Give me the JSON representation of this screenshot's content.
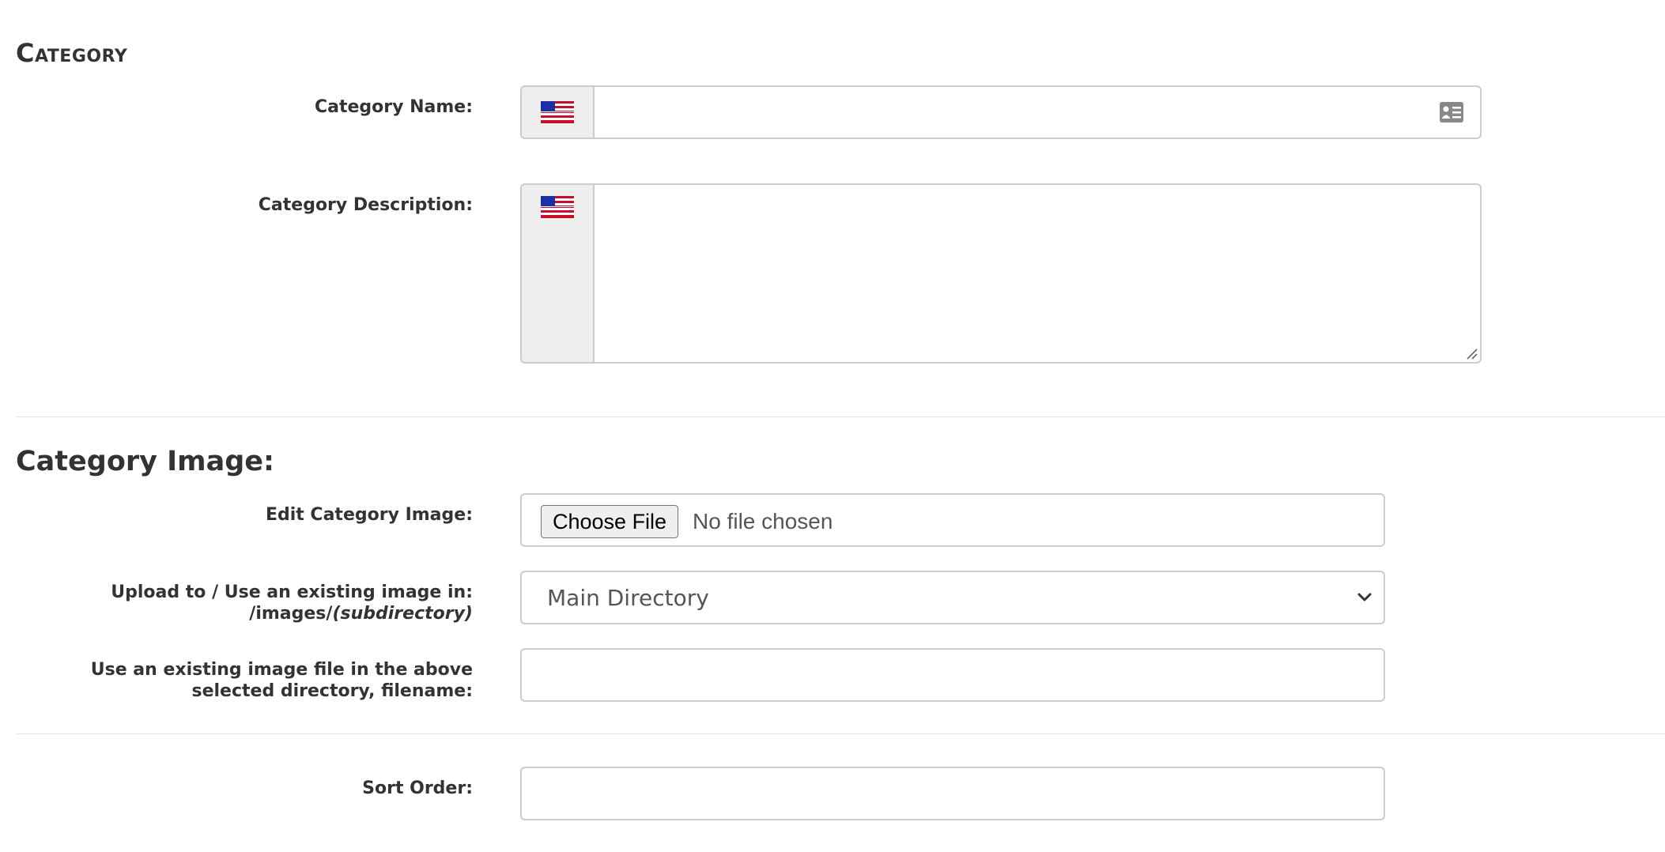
{
  "category_section": {
    "heading": "Category",
    "name_label": "Category Name:",
    "name_value": "",
    "name_flag_icon": "us-flag-icon",
    "name_card_icon": "contact-card-icon",
    "description_label": "Category Description:",
    "description_value": "",
    "description_flag_icon": "us-flag-icon"
  },
  "image_section": {
    "heading": "Category Image:",
    "edit_label": "Edit Category Image:",
    "choose_file_label": "Choose File",
    "no_file_text": "No file chosen",
    "upload_label_line1": "Upload to / Use an existing image in:",
    "upload_label_line2_prefix": "/images/",
    "upload_label_line2_em": "(subdirectory)",
    "directory_selected": "Main Directory",
    "existing_label_line1": "Use an existing image file in the above",
    "existing_label_line2": "selected directory, filename:",
    "existing_value": ""
  },
  "sort_section": {
    "label": "Sort Order:",
    "value": ""
  },
  "colors": {
    "text": "#333333",
    "border": "#cccccc",
    "addon_bg": "#eeeeee",
    "divider": "#e6e6e6"
  }
}
